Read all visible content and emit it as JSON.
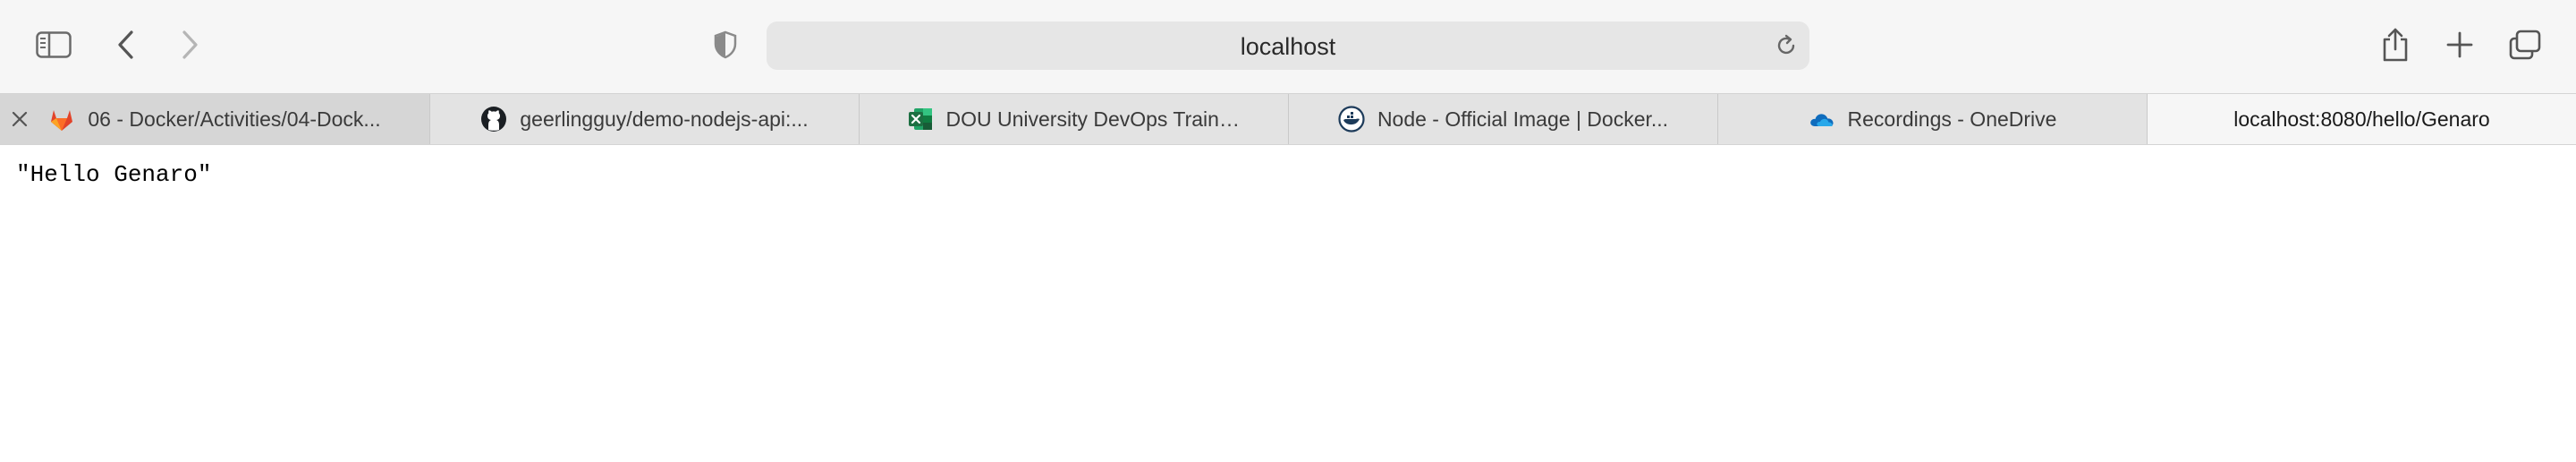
{
  "toolbar": {
    "address": "localhost",
    "icons": {
      "sidebar": "sidebar-icon",
      "back": "chevron-left-icon",
      "forward": "chevron-right-icon",
      "privacy": "shield-icon",
      "reload": "reload-icon",
      "share": "share-icon",
      "new_tab": "plus-icon",
      "tab_overview": "tabs-overview-icon"
    }
  },
  "tabs": [
    {
      "title": "06 - Docker/Activities/04-Dock...",
      "favicon": "gitlab-icon"
    },
    {
      "title": "geerlingguy/demo-nodejs-api:...",
      "favicon": "github-icon"
    },
    {
      "title": "DOU University DevOps Trainin...",
      "favicon": "excel-icon"
    },
    {
      "title": "Node - Official Image | Docker...",
      "favicon": "docker-icon"
    },
    {
      "title": "Recordings - OneDrive",
      "favicon": "onedrive-icon"
    },
    {
      "title": "localhost:8080/hello/Genaro",
      "active": true
    }
  ],
  "page": {
    "body_text": "\"Hello Genaro\""
  },
  "colors": {
    "toolbar_bg": "#f6f6f6",
    "tabbar_bg": "#e3e3e3",
    "address_bg": "#e6e6e6",
    "gitlab": "#e2432a",
    "excel": "#1d6f42",
    "onedrive": "#0f6cbd"
  }
}
